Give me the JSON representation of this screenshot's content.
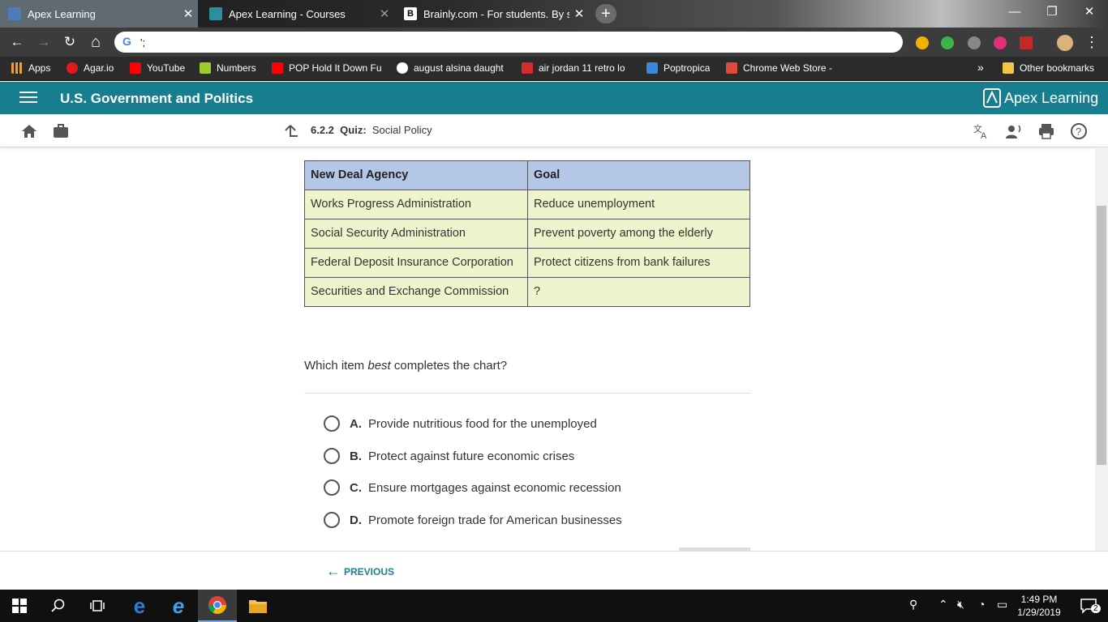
{
  "browser": {
    "tabs": [
      {
        "title": "Apex Learning",
        "active": true
      },
      {
        "title": "Apex Learning - Courses",
        "active": false
      },
      {
        "title": "Brainly.com - For students. By stu",
        "active": false
      }
    ],
    "new_tab": "+",
    "window_controls": {
      "minimize": "—",
      "restore": "❐",
      "close": "✕"
    },
    "nav": {
      "back": "←",
      "forward": "→",
      "reload": "↻",
      "home": "⌂"
    },
    "address_value": "';",
    "omnibox_icon": "G",
    "menu": "⋮",
    "bookmarks": [
      {
        "label": "Apps",
        "color": "#e9a23b"
      },
      {
        "label": "Agar.io",
        "color": "#e01b1b"
      },
      {
        "label": "YouTube",
        "color": "#ff0000"
      },
      {
        "label": "Numbers",
        "color": "#9ccc2b"
      },
      {
        "label": "POP Hold It Down Fu",
        "color": "#ff0000"
      },
      {
        "label": "august alsina daught",
        "color": "#4285f4"
      },
      {
        "label": "air jordan 11 retro lo",
        "color": "#d62b2b"
      },
      {
        "label": "Poptropica",
        "color": "#3b88d8"
      },
      {
        "label": "Chrome Web Store -",
        "color": "#e04a3b"
      }
    ],
    "bookmarks_more": "»",
    "other_bookmarks": "Other bookmarks"
  },
  "app": {
    "course_title": "U.S. Government and Politics",
    "logo_text": "Apex Learning",
    "quiz_number": "6.2.2",
    "quiz_label": "Quiz:",
    "quiz_title": "Social Policy"
  },
  "question": {
    "table": {
      "headers": [
        "New Deal Agency",
        "Goal"
      ],
      "rows": [
        [
          "Works Progress Administration",
          "Reduce unemployment"
        ],
        [
          "Social Security Administration",
          "Prevent poverty among the elderly"
        ],
        [
          "Federal Deposit Insurance Corporation",
          "Protect citizens from bank failures"
        ],
        [
          "Securities and Exchange Commission",
          "?"
        ]
      ]
    },
    "prompt_pre": "Which item ",
    "prompt_em": "best",
    "prompt_post": " completes the chart?",
    "options": [
      {
        "letter": "A.",
        "text": "Provide nutritious food for the unemployed"
      },
      {
        "letter": "B.",
        "text": "Protect against future economic crises"
      },
      {
        "letter": "C.",
        "text": "Ensure mortgages against economic recession"
      },
      {
        "letter": "D.",
        "text": "Promote foreign trade for American businesses"
      }
    ]
  },
  "footer": {
    "previous_label": "PREVIOUS"
  },
  "taskbar": {
    "time": "1:49 PM",
    "date": "1/29/2019",
    "notifications": "2"
  },
  "colors": {
    "accent": "#167e8f",
    "table_header": "#b4c7e7",
    "table_cell": "#eef5cc"
  }
}
